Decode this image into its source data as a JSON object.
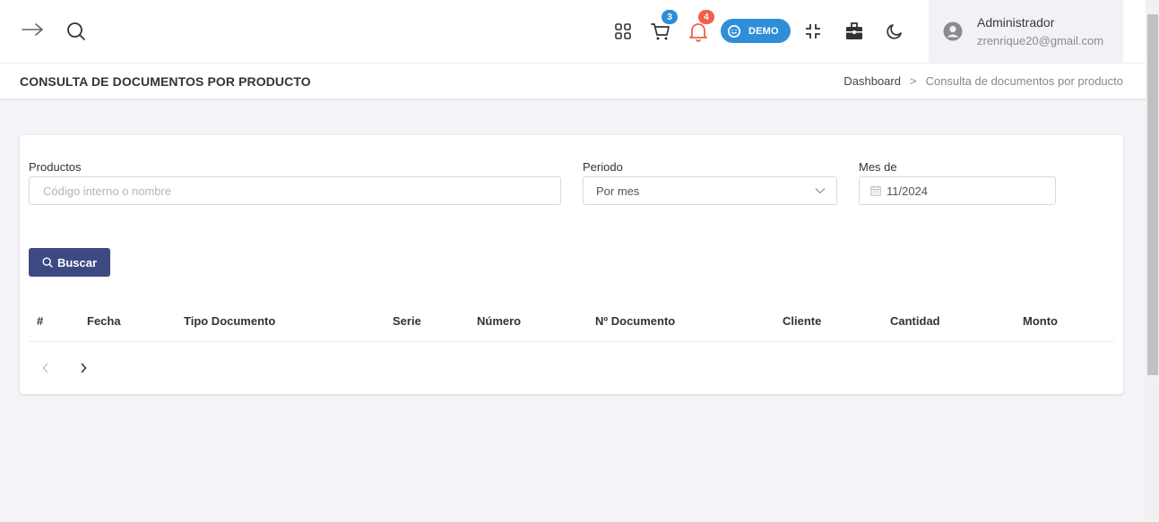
{
  "topbar": {
    "cart_count": "3",
    "notif_count": "4",
    "demo_label": "DEMO",
    "user_name": "Administrador",
    "user_email": "zrenrique20@gmail.com",
    "colors": {
      "cart_badge": "#2e8fd8",
      "notif_badge": "#f0604a",
      "demo_pill": "#2e8fd8"
    }
  },
  "page": {
    "title": "CONSULTA DE DOCUMENTOS POR PRODUCTO",
    "breadcrumb": {
      "home": "Dashboard",
      "separator": ">",
      "current": "Consulta de documentos por producto"
    }
  },
  "form": {
    "productos_label": "Productos",
    "productos_placeholder": "Código interno o nombre",
    "periodo_label": "Periodo",
    "periodo_value": "Por mes",
    "mes_label": "Mes de",
    "mes_value": "11/2024",
    "buscar_label": "Buscar",
    "button_color": "#3d4a82"
  },
  "table": {
    "columns": [
      "#",
      "Fecha",
      "Tipo Documento",
      "Serie",
      "Número",
      "Nº Documento",
      "Cliente",
      "Cantidad",
      "Monto"
    ],
    "rows": []
  }
}
